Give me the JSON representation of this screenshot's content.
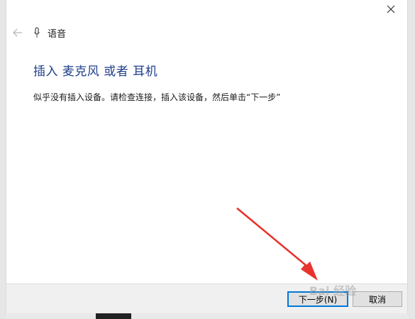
{
  "window": {
    "title": "语音"
  },
  "page": {
    "heading": "插入 麦克风 或者 耳机",
    "instruction": "似乎没有插入设备。请检查连接，插入该设备，然后单击“下一步”"
  },
  "buttons": {
    "next_label": "下一步(N)",
    "cancel_label": "取消"
  },
  "watermark": {
    "text": "Bai 经验"
  },
  "icons": {
    "back": "back-arrow-icon",
    "microphone": "microphone-icon",
    "close": "close-icon",
    "annotation": "red-arrow-icon"
  },
  "colors": {
    "heading": "#1f3f8a",
    "primary_button_border": "#0078d7",
    "annotation_arrow": "#e8302a"
  }
}
